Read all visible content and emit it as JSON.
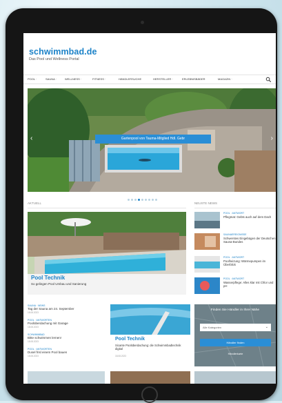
{
  "site": {
    "logo": "schwimmbad.de",
    "tagline": "Das Pool und Wellness Portal"
  },
  "nav": {
    "items": [
      "POOL ·",
      "SAUNA ·",
      "WELLNESS ·",
      "FITNESS ·",
      "HÄNDLERSUCHE",
      "HERSTELLER ·",
      "ERLEBNISBÄDER",
      "MAGAZIN ·"
    ],
    "search_icon": "search-icon"
  },
  "hero": {
    "caption": "Gartenpool von Tauma-Mitglied Hdl. Gebr",
    "slides_count": 9,
    "active_slide": 3
  },
  "sections": {
    "current_label": "AKTUELL",
    "latest_label": "NEUSTE NEWS"
  },
  "featured": {
    "title": "Pool Technik",
    "subtitle": "So gelingen Pool Umbau und Sanierung"
  },
  "sidebar_news": [
    {
      "kicker": "POOL · ANTWORT",
      "title": "Pflegmat: Gebts auch auf dem Dach"
    },
    {
      "kicker": "SAUNAEREIGNISSE",
      "title": "Schwerstes Eingebügen der Deutschen Sauna-Bundes"
    },
    {
      "kicker": "POOL · ANTWORT",
      "title": "Poolheizung: Wärmepumpen im Überblick"
    },
    {
      "kicker": "POOL · ANTWORT",
      "title": "Wasserpflege: Alles klar mit Chlor und pH"
    }
  ],
  "news_list": [
    {
      "kicker": "SAUNA · NEWS",
      "title": "Tag der Sauna am 24. September",
      "date": "18.08.2023"
    },
    {
      "kicker": "POOL · ANTWORTEN",
      "title": "Poolüberdachung mit Garage",
      "date": "18.08.2023"
    },
    {
      "kicker": "SCHWIMMBAD",
      "title": "Bitte schwimmen lernen!",
      "date": "18.08.2023"
    },
    {
      "kicker": "POOL · ANTWORTEN",
      "title": "Dusel frisl einem Pool bauen",
      "date": "18.08.2023"
    }
  ],
  "card2": {
    "title": "Pool Technik",
    "description": "Sicante Poolüberdachung: die Schwimmbadtechnik digital",
    "meta": "18.08.2023"
  },
  "widget": {
    "title": "Finden Sie Händler in Ihrer Nähe",
    "select_value": "Alle Kategorien",
    "button_label": "Händler finden",
    "link": "Händlerkarte"
  }
}
